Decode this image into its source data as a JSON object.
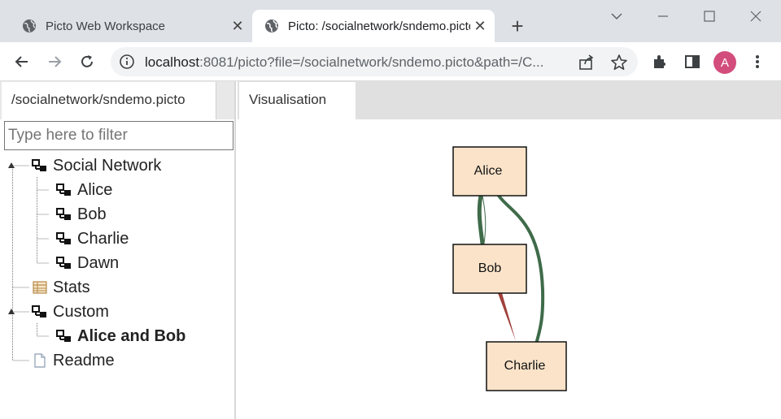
{
  "browser": {
    "tabs": [
      {
        "title": "Picto Web Workspace",
        "active": false
      },
      {
        "title": "Picto: /socialnetwork/sndemo.picto",
        "active": true
      }
    ],
    "url_host": "localhost",
    "url_rest": ":8081/picto?file=/socialnetwork/sndemo.picto&path=/C...",
    "profile_initial": "A",
    "colors": {
      "tabstrip": "#dee1e6",
      "avatar": "#d34d7c"
    }
  },
  "left_panel": {
    "tab_label": "/socialnetwork/sndemo.picto",
    "filter_placeholder": "Type here to filter",
    "tree": [
      {
        "label": "Social Network",
        "icon": "view-icon"
      },
      {
        "label": "Alice",
        "icon": "view-icon"
      },
      {
        "label": "Bob",
        "icon": "view-icon"
      },
      {
        "label": "Charlie",
        "icon": "view-icon"
      },
      {
        "label": "Dawn",
        "icon": "view-icon"
      },
      {
        "label": "Stats",
        "icon": "table-icon"
      },
      {
        "label": "Custom",
        "icon": "view-icon"
      },
      {
        "label": "Alice and Bob",
        "icon": "view-icon"
      },
      {
        "label": "Readme",
        "icon": "document-icon"
      }
    ]
  },
  "right_panel": {
    "tab_label": "Visualisation",
    "graph": {
      "nodes": [
        "Alice",
        "Bob",
        "Charlie"
      ],
      "node_fill": "#fae3c9",
      "edge_colors": {
        "positive": "#3f6b4a",
        "negative": "#a0413b"
      }
    }
  }
}
